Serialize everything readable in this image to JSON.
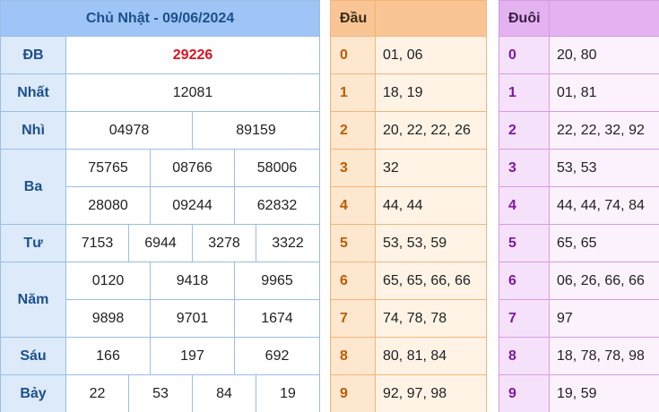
{
  "results": {
    "title": "Chủ Nhật - 09/06/2024",
    "prizes": {
      "db": {
        "label": "ĐB",
        "values": [
          "29226"
        ]
      },
      "nhat": {
        "label": "Nhất",
        "values": [
          "12081"
        ]
      },
      "nhi": {
        "label": "Nhì",
        "values": [
          "04978",
          "89159"
        ]
      },
      "ba": {
        "label": "Ba",
        "values": [
          "75765",
          "08766",
          "58006",
          "28080",
          "09244",
          "62832"
        ]
      },
      "tu": {
        "label": "Tư",
        "values": [
          "7153",
          "6944",
          "3278",
          "3322"
        ]
      },
      "nam": {
        "label": "Năm",
        "values": [
          "0120",
          "9418",
          "9965",
          "9898",
          "9701",
          "1674"
        ]
      },
      "sau": {
        "label": "Sáu",
        "values": [
          "166",
          "197",
          "692"
        ]
      },
      "bay": {
        "label": "Bảy",
        "values": [
          "22",
          "53",
          "84",
          "19"
        ]
      }
    },
    "colors": {
      "header": "#9ec5f5",
      "label_bg": "#dceaf9",
      "special": "#e0101e"
    }
  },
  "head": {
    "title": "Đầu",
    "rows": [
      {
        "digit": "0",
        "numbers": "01, 06"
      },
      {
        "digit": "1",
        "numbers": "18, 19"
      },
      {
        "digit": "2",
        "numbers": "20, 22, 22, 26"
      },
      {
        "digit": "3",
        "numbers": "32"
      },
      {
        "digit": "4",
        "numbers": "44, 44"
      },
      {
        "digit": "5",
        "numbers": "53, 53, 59"
      },
      {
        "digit": "6",
        "numbers": "65, 65, 66, 66"
      },
      {
        "digit": "7",
        "numbers": "74, 78, 78"
      },
      {
        "digit": "8",
        "numbers": "80, 81, 84"
      },
      {
        "digit": "9",
        "numbers": "92, 97, 98"
      }
    ]
  },
  "tail": {
    "title": "Đuôi",
    "rows": [
      {
        "digit": "0",
        "numbers": "20, 80"
      },
      {
        "digit": "1",
        "numbers": "01, 81"
      },
      {
        "digit": "2",
        "numbers": "22, 22, 32, 92"
      },
      {
        "digit": "3",
        "numbers": "53, 53"
      },
      {
        "digit": "4",
        "numbers": "44, 44, 74, 84"
      },
      {
        "digit": "5",
        "numbers": "65, 65"
      },
      {
        "digit": "6",
        "numbers": "06, 26, 66, 66"
      },
      {
        "digit": "7",
        "numbers": "97"
      },
      {
        "digit": "8",
        "numbers": "18, 78, 78, 98"
      },
      {
        "digit": "9",
        "numbers": "19, 59"
      }
    ]
  }
}
